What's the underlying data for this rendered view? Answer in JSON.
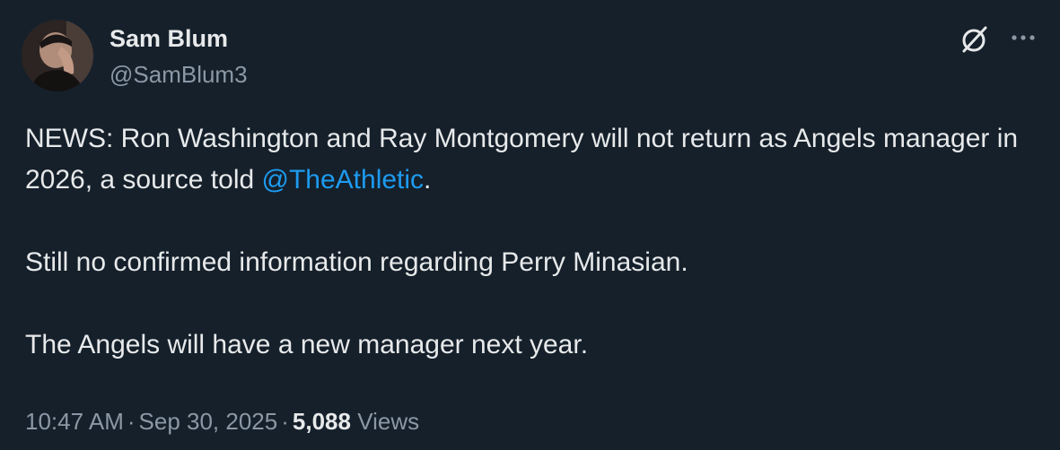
{
  "author": {
    "name": "Sam Blum",
    "handle": "@SamBlum3"
  },
  "icons": {
    "grok": "grok-icon",
    "more": "more-horizontal-icon"
  },
  "tweet": {
    "line1_pre": "NEWS: Ron Washington and Ray Montgomery will not return as Angels manager in 2026, a source told ",
    "mention": "@TheAthletic",
    "line1_post": ".",
    "paragraph2": "Still no confirmed information regarding Perry Minasian.",
    "paragraph3": "The Angels will have a new manager next year."
  },
  "meta": {
    "time": "10:47 AM",
    "date": "Sep 30, 2025",
    "separator": "·",
    "views_count": "5,088",
    "views_label": "Views"
  },
  "colors": {
    "background": "#15202b",
    "text": "#e7e9ea",
    "secondary": "#8b98a5",
    "link": "#1d9bf0"
  }
}
